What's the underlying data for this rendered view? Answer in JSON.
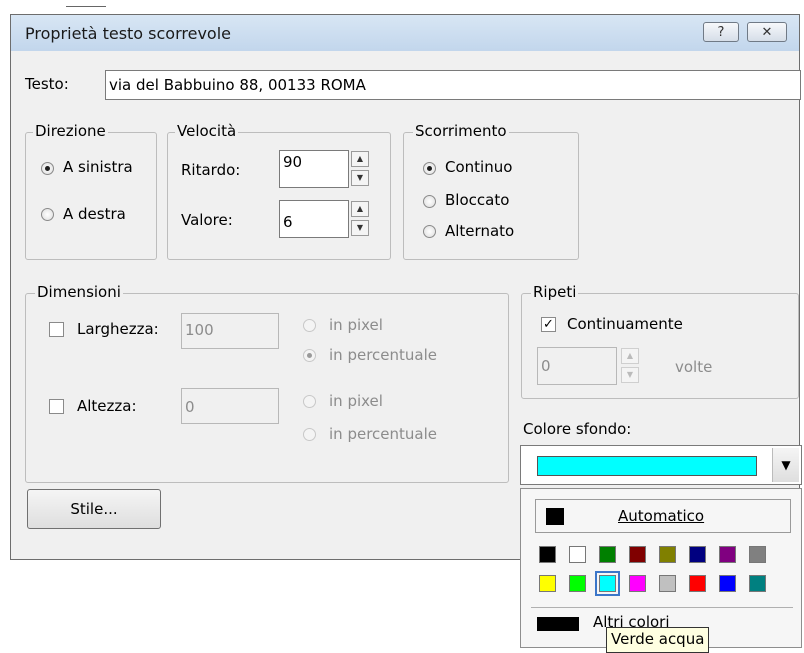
{
  "dialog": {
    "title": "Proprietà testo scorrevole",
    "help_label": "?",
    "close_label": "✕"
  },
  "testo": {
    "label": "Testo:",
    "value": "via del Babbuino 88, 00133 ROMA"
  },
  "direzione": {
    "legend": "Direzione",
    "options": [
      {
        "label": "A sinistra",
        "selected": true
      },
      {
        "label": "A destra",
        "selected": false
      }
    ]
  },
  "velocita": {
    "legend": "Velocità",
    "ritardo_label": "Ritardo:",
    "ritardo_value": "90",
    "valore_label": "Valore:",
    "valore_value": "6"
  },
  "scorrimento": {
    "legend": "Scorrimento",
    "options": [
      {
        "label": "Continuo",
        "selected": true
      },
      {
        "label": "Bloccato",
        "selected": false
      },
      {
        "label": "Alternato",
        "selected": false
      }
    ]
  },
  "dimensioni": {
    "legend": "Dimensioni",
    "larghezza_label": "Larghezza:",
    "larghezza_value": "100",
    "larghezza_checked": false,
    "altezza_label": "Altezza:",
    "altezza_value": "0",
    "altezza_checked": false,
    "unit_pixel": "in pixel",
    "unit_percent": "in percentuale"
  },
  "ripeti": {
    "legend": "Ripeti",
    "continuamente_label": "Continuamente",
    "continuamente_checked": true,
    "count_value": "0",
    "volte_label": "volte"
  },
  "colore": {
    "label": "Colore sfondo:",
    "selected_color": "#00ffff",
    "automatico_label": "Automatico",
    "altri_label": "Altri colori",
    "tooltip": "Verde acqua",
    "swatches_row1": [
      "#000000",
      "#ffffff",
      "#008000",
      "#800000",
      "#808000",
      "#000080",
      "#800080",
      "#808080"
    ],
    "swatches_row2": [
      "#ffff00",
      "#00ff00",
      "#00ffff",
      "#ff00ff",
      "#c0c0c0",
      "#ff0000",
      "#0000ff",
      "#008080"
    ]
  },
  "stile_button": "Stile..."
}
